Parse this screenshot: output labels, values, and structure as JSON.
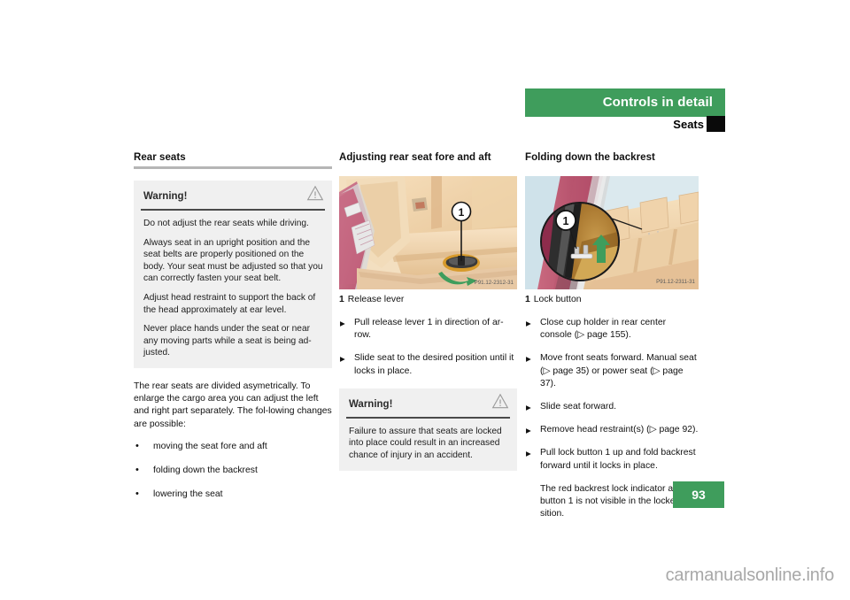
{
  "header": {
    "chapter_title": "Controls in detail",
    "section_title": "Seats",
    "green_color": "#3f9d5c"
  },
  "page_number": "93",
  "watermark": "carmanualsonline.info",
  "columns": {
    "left": {
      "heading": "Rear seats",
      "warning": {
        "label": "Warning!",
        "icon": "warning-triangle-icon",
        "paragraphs": [
          "Do not adjust the rear seats while driving.",
          "Always seat in an upright position and the seat belts are properly positioned on the body. Your seat must be adjusted so that you can correctly fasten your seat belt.",
          "Adjust head restraint to support the back of the head approximately at ear level.",
          "Never place hands under the seat or near any moving parts while a seat is being ad-justed."
        ]
      },
      "intro": "The rear seats are divided asymetrically. To enlarge the cargo area you can adjust the left and right part separately. The fol-lowing changes are possible:",
      "bullets": [
        "moving the seat fore and aft",
        "folding down the backrest",
        "lowering the seat"
      ]
    },
    "middle": {
      "heading": "Adjusting rear seat fore and aft",
      "figure": {
        "name": "rear-seat-release-lever-illustration",
        "code": "P91.12-2312-31",
        "callout": "1"
      },
      "caption_number": "1",
      "caption_text": "Release lever",
      "steps": [
        "Pull release lever 1 in direction of ar-row.",
        "Slide seat to the desired position until it locks in place."
      ],
      "warning": {
        "label": "Warning!",
        "icon": "warning-triangle-icon",
        "paragraphs": [
          "Failure to assure that seats are locked into place could result in an increased chance of injury in an accident."
        ]
      }
    },
    "right": {
      "heading": "Folding down the backrest",
      "figure": {
        "name": "backrest-lock-button-illustration",
        "code": "P91.12-2311-31",
        "callout": "1"
      },
      "caption_number": "1",
      "caption_text": "Lock button",
      "steps": [
        "Close cup holder in rear center console (▷ page 155).",
        "Move front seats forward. Manual seat (▷ page 35) or power seat (▷ page 37).",
        "Slide seat forward.",
        "Remove head restraint(s) (▷ page 92).",
        "Pull lock button 1 up and fold backrest forward until it locks in place."
      ],
      "note": "The red backrest lock indicator at lock button 1 is not visible in the locked po-sition."
    }
  }
}
